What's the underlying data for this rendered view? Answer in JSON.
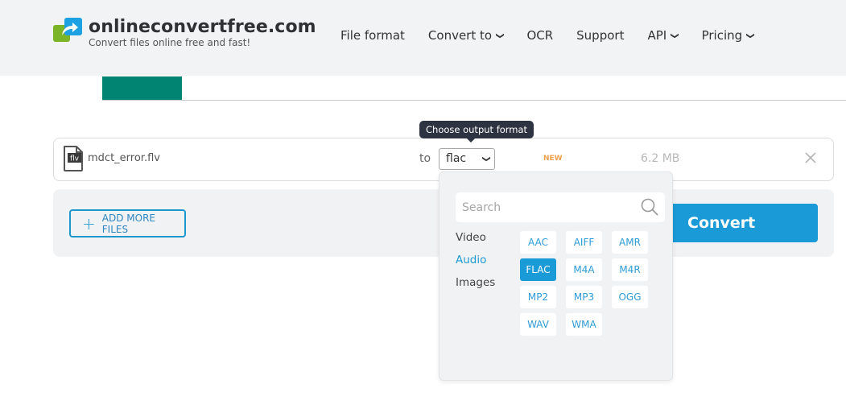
{
  "header": {
    "logo_title": "onlineconvertfree.com",
    "logo_subtitle": "Convert files online free and fast!",
    "nav": [
      {
        "label": "File format",
        "has_dropdown": false
      },
      {
        "label": "Convert to",
        "has_dropdown": true
      },
      {
        "label": "OCR",
        "has_dropdown": false
      },
      {
        "label": "Support",
        "has_dropdown": false
      },
      {
        "label": "API",
        "has_dropdown": true
      },
      {
        "label": "Pricing",
        "has_dropdown": true
      }
    ]
  },
  "colors": {
    "brand_teal": "#018572",
    "accent_blue": "#1a9ad6",
    "new_badge": "#f0a04b",
    "logo_green": "#7bb427",
    "logo_blue": "#1ea1e2"
  },
  "file": {
    "icon_label": "flv",
    "name": "mdct_error.flv",
    "to_label": "to",
    "selected_format": "flac",
    "badge": "NEW",
    "size": "6.2 MB"
  },
  "tooltip": "Choose output format",
  "actions": {
    "add_more_label": "ADD MORE FILES",
    "convert_label": "Convert"
  },
  "dropdown": {
    "search_placeholder": "Search",
    "categories": [
      {
        "label": "Video",
        "active": false
      },
      {
        "label": "Audio",
        "active": true
      },
      {
        "label": "Images",
        "active": false
      }
    ],
    "formats": [
      {
        "label": "AAC",
        "selected": false
      },
      {
        "label": "AIFF",
        "selected": false
      },
      {
        "label": "AMR",
        "selected": false
      },
      {
        "label": "FLAC",
        "selected": true
      },
      {
        "label": "M4A",
        "selected": false
      },
      {
        "label": "M4R",
        "selected": false
      },
      {
        "label": "MP2",
        "selected": false
      },
      {
        "label": "MP3",
        "selected": false
      },
      {
        "label": "OGG",
        "selected": false
      },
      {
        "label": "WAV",
        "selected": false
      },
      {
        "label": "WMA",
        "selected": false
      }
    ]
  }
}
